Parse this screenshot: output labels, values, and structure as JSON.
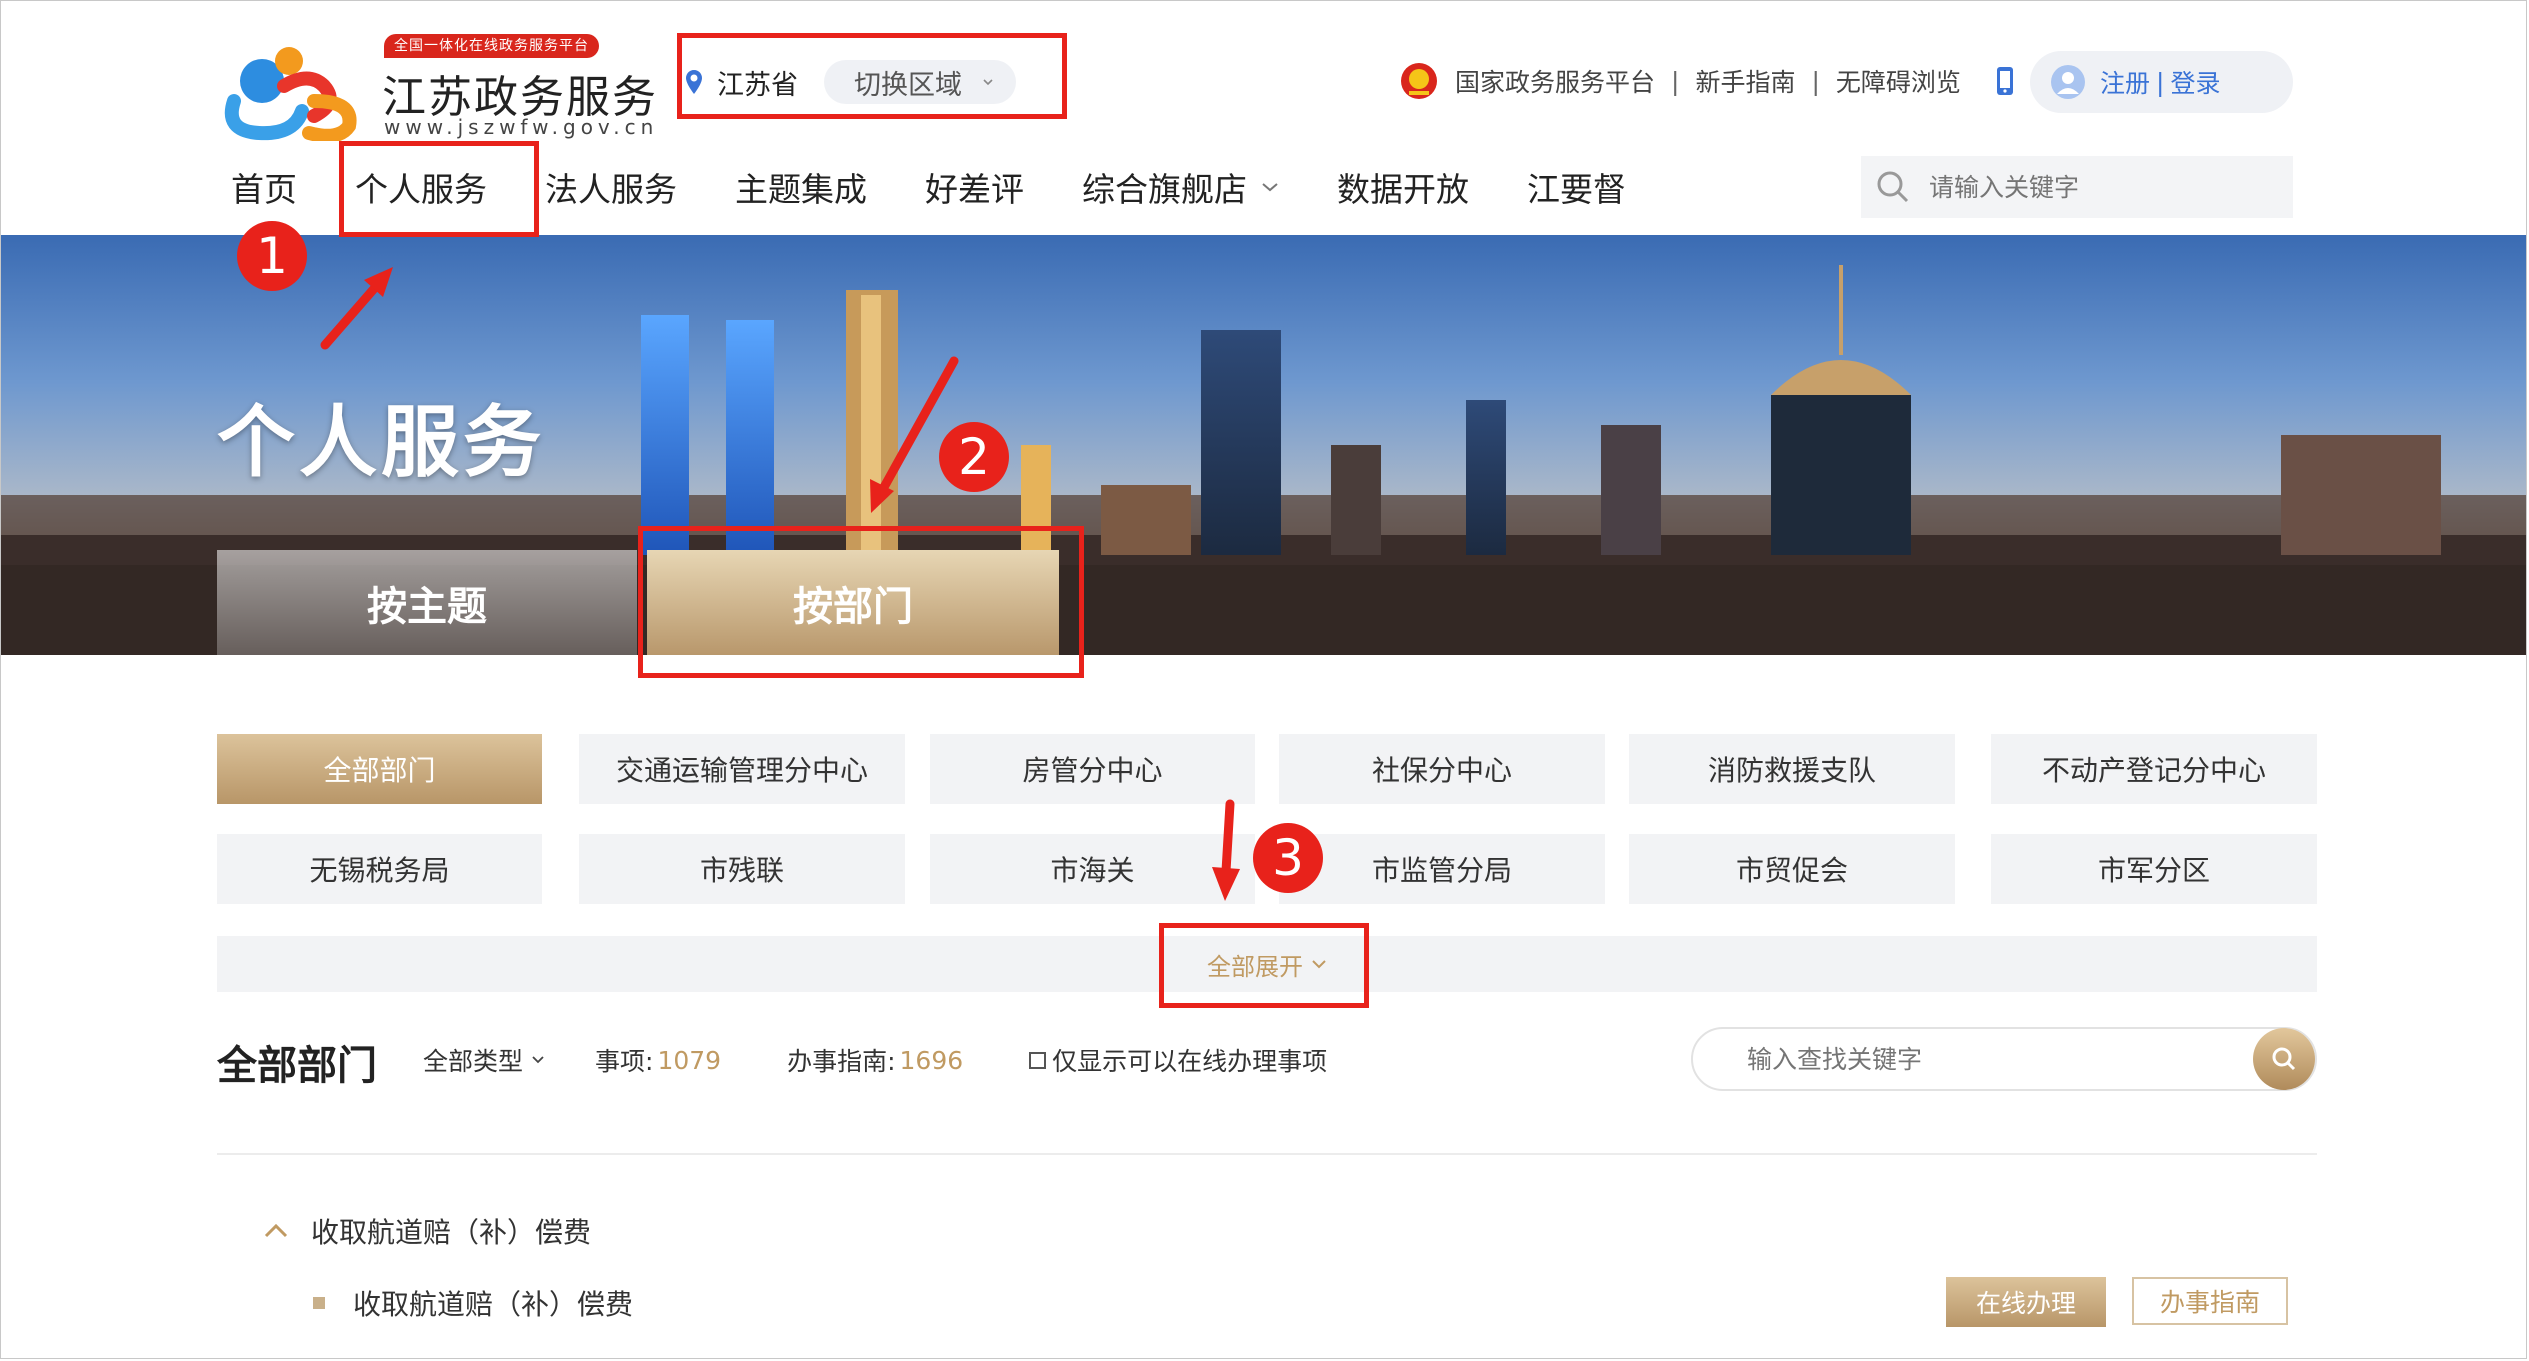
{
  "header": {
    "logo_badge": "全国一体化在线政务服务平台",
    "logo_title": "江苏政务服务",
    "logo_domain": "www.jszwfw.gov.cn",
    "region_name": "江苏省",
    "region_switch": "切换区域",
    "links": {
      "national": "国家政务服务平台",
      "guide": "新手指南",
      "accessible": "无障碍浏览"
    },
    "register": "注册",
    "login": "登录",
    "search_placeholder": "请输入关键字"
  },
  "nav": {
    "items": [
      "首页",
      "个人服务",
      "法人服务",
      "主题集成",
      "好差评",
      "综合旗舰店",
      "数据开放",
      "江要督"
    ]
  },
  "banner": {
    "title": "个人服务",
    "tab_theme": "按主题",
    "tab_dept": "按部门"
  },
  "departments": {
    "row1": [
      "全部部门",
      "交通运输管理分中心",
      "房管分中心",
      "社保分中心",
      "消防救援支队",
      "不动产登记分中心"
    ],
    "row2": [
      "无锡税务局",
      "市残联",
      "市海关",
      "市监管分局",
      "市贸促会",
      "市军分区"
    ],
    "expand": "全部展开"
  },
  "list": {
    "title": "全部部门",
    "type_filter": "全部类型",
    "items_label": "事项:",
    "items_count": "1079",
    "guides_label": "办事指南:",
    "guides_count": "1696",
    "online_only": "仅显示可以在线办理事项",
    "search_placeholder": "输入查找关键字"
  },
  "results": {
    "group_title": "收取航道赔（补）偿费",
    "item_title": "收取航道赔（补）偿费",
    "btn_online": "在线办理",
    "btn_guide": "办事指南"
  },
  "annotations": {
    "step1": "1",
    "step2": "2",
    "step3": "3",
    "color": "#e8221b"
  },
  "colors": {
    "accent_gold": "#c09a62",
    "link_blue": "#3a73d6"
  }
}
